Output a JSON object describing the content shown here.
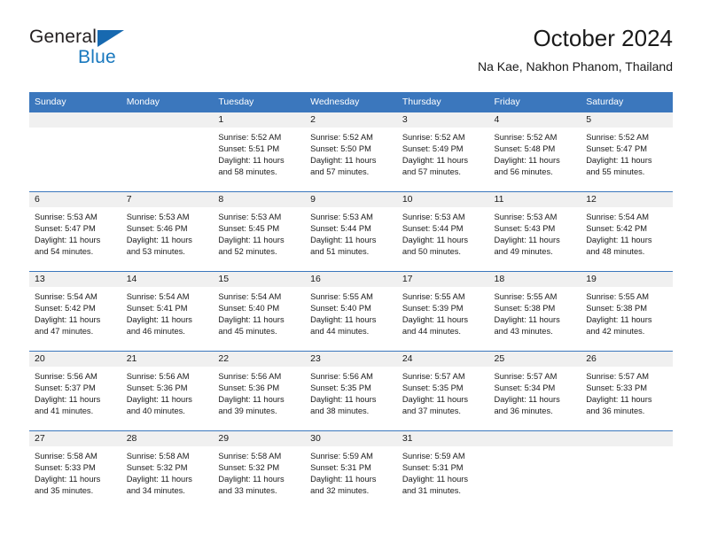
{
  "brand": {
    "name_part1": "General",
    "name_part2": "Blue",
    "triangle_color": "#1769b0",
    "blue_text_color": "#1878be"
  },
  "header": {
    "title": "October 2024",
    "subtitle": "Na Kae, Nakhon Phanom, Thailand"
  },
  "theme": {
    "header_bg": "#3b77bd",
    "daynum_bg": "#f0f0f0",
    "row_divider": "#3b77bd",
    "text": "#1a1a1a"
  },
  "weekday_headers": [
    "Sunday",
    "Monday",
    "Tuesday",
    "Wednesday",
    "Thursday",
    "Friday",
    "Saturday"
  ],
  "weeks": [
    [
      {
        "day": "",
        "empty": true,
        "sunrise": "",
        "sunset": "",
        "daylight_line1": "",
        "daylight_line2": ""
      },
      {
        "day": "",
        "empty": true,
        "sunrise": "",
        "sunset": "",
        "daylight_line1": "",
        "daylight_line2": ""
      },
      {
        "day": "1",
        "empty": false,
        "sunrise": "Sunrise: 5:52 AM",
        "sunset": "Sunset: 5:51 PM",
        "daylight_line1": "Daylight: 11 hours",
        "daylight_line2": "and 58 minutes."
      },
      {
        "day": "2",
        "empty": false,
        "sunrise": "Sunrise: 5:52 AM",
        "sunset": "Sunset: 5:50 PM",
        "daylight_line1": "Daylight: 11 hours",
        "daylight_line2": "and 57 minutes."
      },
      {
        "day": "3",
        "empty": false,
        "sunrise": "Sunrise: 5:52 AM",
        "sunset": "Sunset: 5:49 PM",
        "daylight_line1": "Daylight: 11 hours",
        "daylight_line2": "and 57 minutes."
      },
      {
        "day": "4",
        "empty": false,
        "sunrise": "Sunrise: 5:52 AM",
        "sunset": "Sunset: 5:48 PM",
        "daylight_line1": "Daylight: 11 hours",
        "daylight_line2": "and 56 minutes."
      },
      {
        "day": "5",
        "empty": false,
        "sunrise": "Sunrise: 5:52 AM",
        "sunset": "Sunset: 5:47 PM",
        "daylight_line1": "Daylight: 11 hours",
        "daylight_line2": "and 55 minutes."
      }
    ],
    [
      {
        "day": "6",
        "empty": false,
        "sunrise": "Sunrise: 5:53 AM",
        "sunset": "Sunset: 5:47 PM",
        "daylight_line1": "Daylight: 11 hours",
        "daylight_line2": "and 54 minutes."
      },
      {
        "day": "7",
        "empty": false,
        "sunrise": "Sunrise: 5:53 AM",
        "sunset": "Sunset: 5:46 PM",
        "daylight_line1": "Daylight: 11 hours",
        "daylight_line2": "and 53 minutes."
      },
      {
        "day": "8",
        "empty": false,
        "sunrise": "Sunrise: 5:53 AM",
        "sunset": "Sunset: 5:45 PM",
        "daylight_line1": "Daylight: 11 hours",
        "daylight_line2": "and 52 minutes."
      },
      {
        "day": "9",
        "empty": false,
        "sunrise": "Sunrise: 5:53 AM",
        "sunset": "Sunset: 5:44 PM",
        "daylight_line1": "Daylight: 11 hours",
        "daylight_line2": "and 51 minutes."
      },
      {
        "day": "10",
        "empty": false,
        "sunrise": "Sunrise: 5:53 AM",
        "sunset": "Sunset: 5:44 PM",
        "daylight_line1": "Daylight: 11 hours",
        "daylight_line2": "and 50 minutes."
      },
      {
        "day": "11",
        "empty": false,
        "sunrise": "Sunrise: 5:53 AM",
        "sunset": "Sunset: 5:43 PM",
        "daylight_line1": "Daylight: 11 hours",
        "daylight_line2": "and 49 minutes."
      },
      {
        "day": "12",
        "empty": false,
        "sunrise": "Sunrise: 5:54 AM",
        "sunset": "Sunset: 5:42 PM",
        "daylight_line1": "Daylight: 11 hours",
        "daylight_line2": "and 48 minutes."
      }
    ],
    [
      {
        "day": "13",
        "empty": false,
        "sunrise": "Sunrise: 5:54 AM",
        "sunset": "Sunset: 5:42 PM",
        "daylight_line1": "Daylight: 11 hours",
        "daylight_line2": "and 47 minutes."
      },
      {
        "day": "14",
        "empty": false,
        "sunrise": "Sunrise: 5:54 AM",
        "sunset": "Sunset: 5:41 PM",
        "daylight_line1": "Daylight: 11 hours",
        "daylight_line2": "and 46 minutes."
      },
      {
        "day": "15",
        "empty": false,
        "sunrise": "Sunrise: 5:54 AM",
        "sunset": "Sunset: 5:40 PM",
        "daylight_line1": "Daylight: 11 hours",
        "daylight_line2": "and 45 minutes."
      },
      {
        "day": "16",
        "empty": false,
        "sunrise": "Sunrise: 5:55 AM",
        "sunset": "Sunset: 5:40 PM",
        "daylight_line1": "Daylight: 11 hours",
        "daylight_line2": "and 44 minutes."
      },
      {
        "day": "17",
        "empty": false,
        "sunrise": "Sunrise: 5:55 AM",
        "sunset": "Sunset: 5:39 PM",
        "daylight_line1": "Daylight: 11 hours",
        "daylight_line2": "and 44 minutes."
      },
      {
        "day": "18",
        "empty": false,
        "sunrise": "Sunrise: 5:55 AM",
        "sunset": "Sunset: 5:38 PM",
        "daylight_line1": "Daylight: 11 hours",
        "daylight_line2": "and 43 minutes."
      },
      {
        "day": "19",
        "empty": false,
        "sunrise": "Sunrise: 5:55 AM",
        "sunset": "Sunset: 5:38 PM",
        "daylight_line1": "Daylight: 11 hours",
        "daylight_line2": "and 42 minutes."
      }
    ],
    [
      {
        "day": "20",
        "empty": false,
        "sunrise": "Sunrise: 5:56 AM",
        "sunset": "Sunset: 5:37 PM",
        "daylight_line1": "Daylight: 11 hours",
        "daylight_line2": "and 41 minutes."
      },
      {
        "day": "21",
        "empty": false,
        "sunrise": "Sunrise: 5:56 AM",
        "sunset": "Sunset: 5:36 PM",
        "daylight_line1": "Daylight: 11 hours",
        "daylight_line2": "and 40 minutes."
      },
      {
        "day": "22",
        "empty": false,
        "sunrise": "Sunrise: 5:56 AM",
        "sunset": "Sunset: 5:36 PM",
        "daylight_line1": "Daylight: 11 hours",
        "daylight_line2": "and 39 minutes."
      },
      {
        "day": "23",
        "empty": false,
        "sunrise": "Sunrise: 5:56 AM",
        "sunset": "Sunset: 5:35 PM",
        "daylight_line1": "Daylight: 11 hours",
        "daylight_line2": "and 38 minutes."
      },
      {
        "day": "24",
        "empty": false,
        "sunrise": "Sunrise: 5:57 AM",
        "sunset": "Sunset: 5:35 PM",
        "daylight_line1": "Daylight: 11 hours",
        "daylight_line2": "and 37 minutes."
      },
      {
        "day": "25",
        "empty": false,
        "sunrise": "Sunrise: 5:57 AM",
        "sunset": "Sunset: 5:34 PM",
        "daylight_line1": "Daylight: 11 hours",
        "daylight_line2": "and 36 minutes."
      },
      {
        "day": "26",
        "empty": false,
        "sunrise": "Sunrise: 5:57 AM",
        "sunset": "Sunset: 5:33 PM",
        "daylight_line1": "Daylight: 11 hours",
        "daylight_line2": "and 36 minutes."
      }
    ],
    [
      {
        "day": "27",
        "empty": false,
        "sunrise": "Sunrise: 5:58 AM",
        "sunset": "Sunset: 5:33 PM",
        "daylight_line1": "Daylight: 11 hours",
        "daylight_line2": "and 35 minutes."
      },
      {
        "day": "28",
        "empty": false,
        "sunrise": "Sunrise: 5:58 AM",
        "sunset": "Sunset: 5:32 PM",
        "daylight_line1": "Daylight: 11 hours",
        "daylight_line2": "and 34 minutes."
      },
      {
        "day": "29",
        "empty": false,
        "sunrise": "Sunrise: 5:58 AM",
        "sunset": "Sunset: 5:32 PM",
        "daylight_line1": "Daylight: 11 hours",
        "daylight_line2": "and 33 minutes."
      },
      {
        "day": "30",
        "empty": false,
        "sunrise": "Sunrise: 5:59 AM",
        "sunset": "Sunset: 5:31 PM",
        "daylight_line1": "Daylight: 11 hours",
        "daylight_line2": "and 32 minutes."
      },
      {
        "day": "31",
        "empty": false,
        "sunrise": "Sunrise: 5:59 AM",
        "sunset": "Sunset: 5:31 PM",
        "daylight_line1": "Daylight: 11 hours",
        "daylight_line2": "and 31 minutes."
      },
      {
        "day": "",
        "empty": true,
        "sunrise": "",
        "sunset": "",
        "daylight_line1": "",
        "daylight_line2": ""
      },
      {
        "day": "",
        "empty": true,
        "sunrise": "",
        "sunset": "",
        "daylight_line1": "",
        "daylight_line2": ""
      }
    ]
  ]
}
